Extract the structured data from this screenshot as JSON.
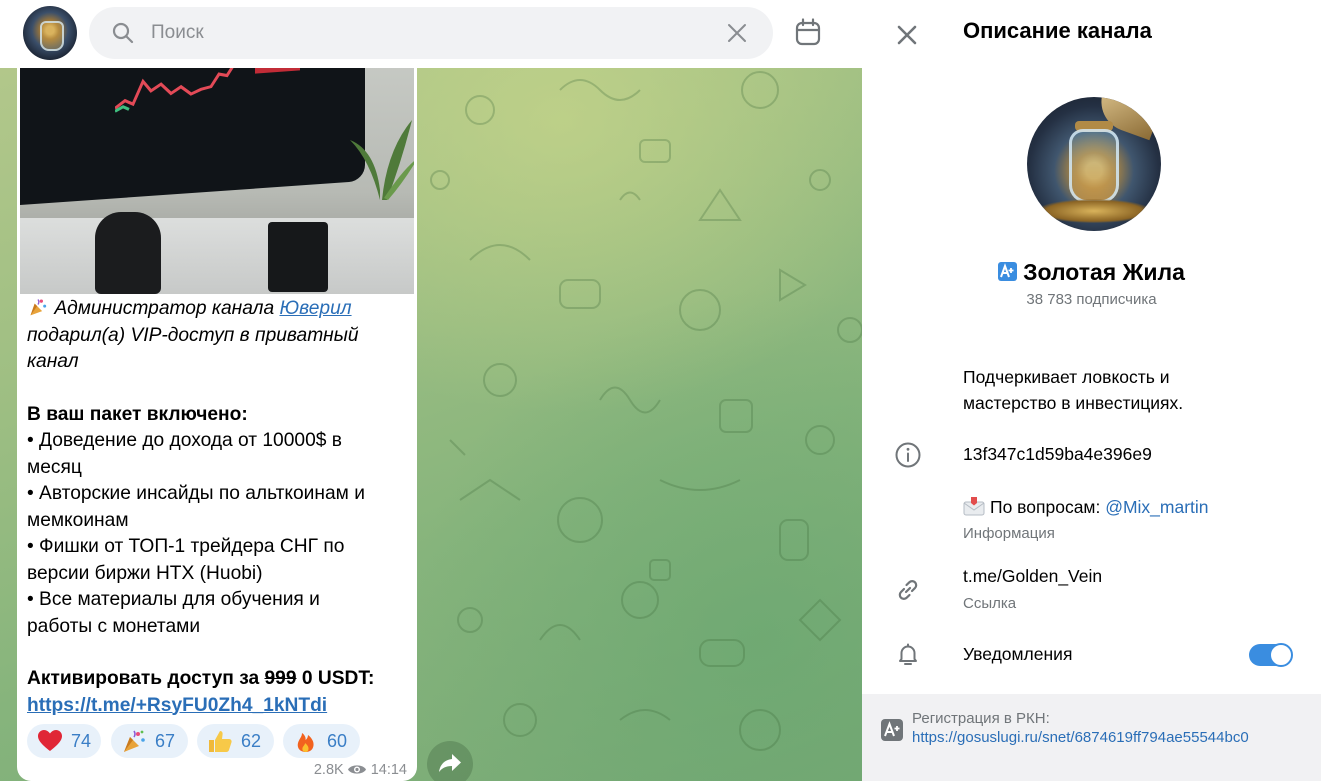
{
  "search": {
    "placeholder": "Поиск"
  },
  "message": {
    "admin_line_prefix": " Администратор канала ",
    "admin_name": "Юверил",
    "gift_line_1": "подарил(а) VIP-доступ в приватный",
    "gift_line_2": "канал",
    "package_heading": "В ваш пакет включено:",
    "bullets": [
      {
        "line1": "•  Доведение до дохода от 10000$ в",
        "line2": "месяц"
      },
      {
        "line1": "•  Авторские инсайды по альткоинам и",
        "line2": "мемкоинам"
      },
      {
        "line1": "•  Фишки от ТОП-1 трейдера СНГ по",
        "line2": "версии биржи HTX (Huobi)"
      },
      {
        "line1": "•  Все материалы для обучения и",
        "line2": "работы с монетами"
      }
    ],
    "activate_prefix": "Активировать доступ за ",
    "old_price": "999",
    "new_price": " 0 USDT:",
    "activate_link": "https://t.me/+RsyFU0Zh4_1kNTdi",
    "reactions": [
      {
        "emoji": "heart",
        "count": "74"
      },
      {
        "emoji": "party-popper",
        "count": "67"
      },
      {
        "emoji": "thumbs-up",
        "count": "62"
      },
      {
        "emoji": "fire",
        "count": "60"
      }
    ],
    "views": "2.8K",
    "time": "14:14"
  },
  "info_panel": {
    "title": "Описание канала",
    "channel_name": "Золотая Жила",
    "subscribers": "38 783 подписчика",
    "description_line_1": "Подчеркивает ловкость и",
    "description_line_2": "мастерство в инвестициях.",
    "id_value": "13f347c1d59ba4e396e9",
    "contact_prefix": "По вопросам: ",
    "contact_handle": "@Mix_martin",
    "contact_label": "Информация",
    "link_value": "t.me/Golden_Vein",
    "link_label": "Ссылка",
    "notifications_label": "Уведомления",
    "notifications_enabled": true,
    "rkn_label": "Регистрация в РКН:",
    "rkn_link": "https://gosuslugi.ru/snet/6874619ff794ae55544bc0"
  },
  "colors": {
    "accent": "#3a8de0",
    "link": "#2a6eb7",
    "reaction_bg": "#e8f1fa"
  }
}
